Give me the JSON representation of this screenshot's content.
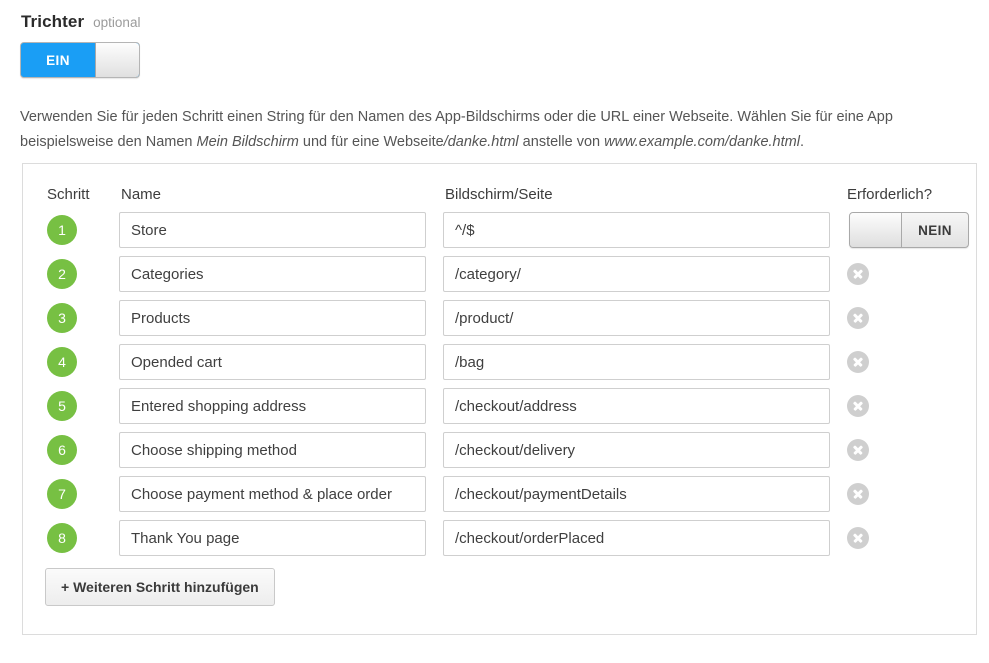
{
  "section": {
    "title": "Trichter",
    "optional_label": "optional"
  },
  "main_toggle": {
    "state_label": "EIN",
    "accent_color": "#1a9ef5",
    "is_on": true
  },
  "description": {
    "part1": "Verwenden Sie für jeden Schritt einen String für den Namen des App-Bildschirms oder die URL einer Webseite. Wählen Sie für eine App beispielsweise den Namen ",
    "em1": "Mein Bildschirm",
    "part2": " und für eine Webseite",
    "em2": "/danke.html",
    "part3": " anstelle von ",
    "em3": "www.example.com/danke.html",
    "part4": "."
  },
  "table": {
    "headers": {
      "step": "Schritt",
      "name": "Name",
      "screen": "Bildschirm/Seite",
      "required": "Erforderlich?"
    },
    "badge_color": "#77c043",
    "rows": [
      {
        "step": "1",
        "name": "Store",
        "screen": "^/$"
      },
      {
        "step": "2",
        "name": "Categories",
        "screen": "/category/"
      },
      {
        "step": "3",
        "name": "Products",
        "screen": "/product/"
      },
      {
        "step": "4",
        "name": "Opended cart",
        "screen": "/bag"
      },
      {
        "step": "5",
        "name": "Entered shopping address",
        "screen": "/checkout/address"
      },
      {
        "step": "6",
        "name": "Choose shipping method",
        "screen": "/checkout/delivery"
      },
      {
        "step": "7",
        "name": "Choose payment method & place order",
        "screen": "/checkout/paymentDetails"
      },
      {
        "step": "8",
        "name": "Thank You page",
        "screen": "/checkout/orderPlaced"
      }
    ],
    "required_toggle": {
      "state_label": "NEIN",
      "is_on": false
    },
    "delete_icon": "close-circle-icon"
  },
  "add_step_button": {
    "label": "+ Weiteren Schritt hinzufügen"
  }
}
